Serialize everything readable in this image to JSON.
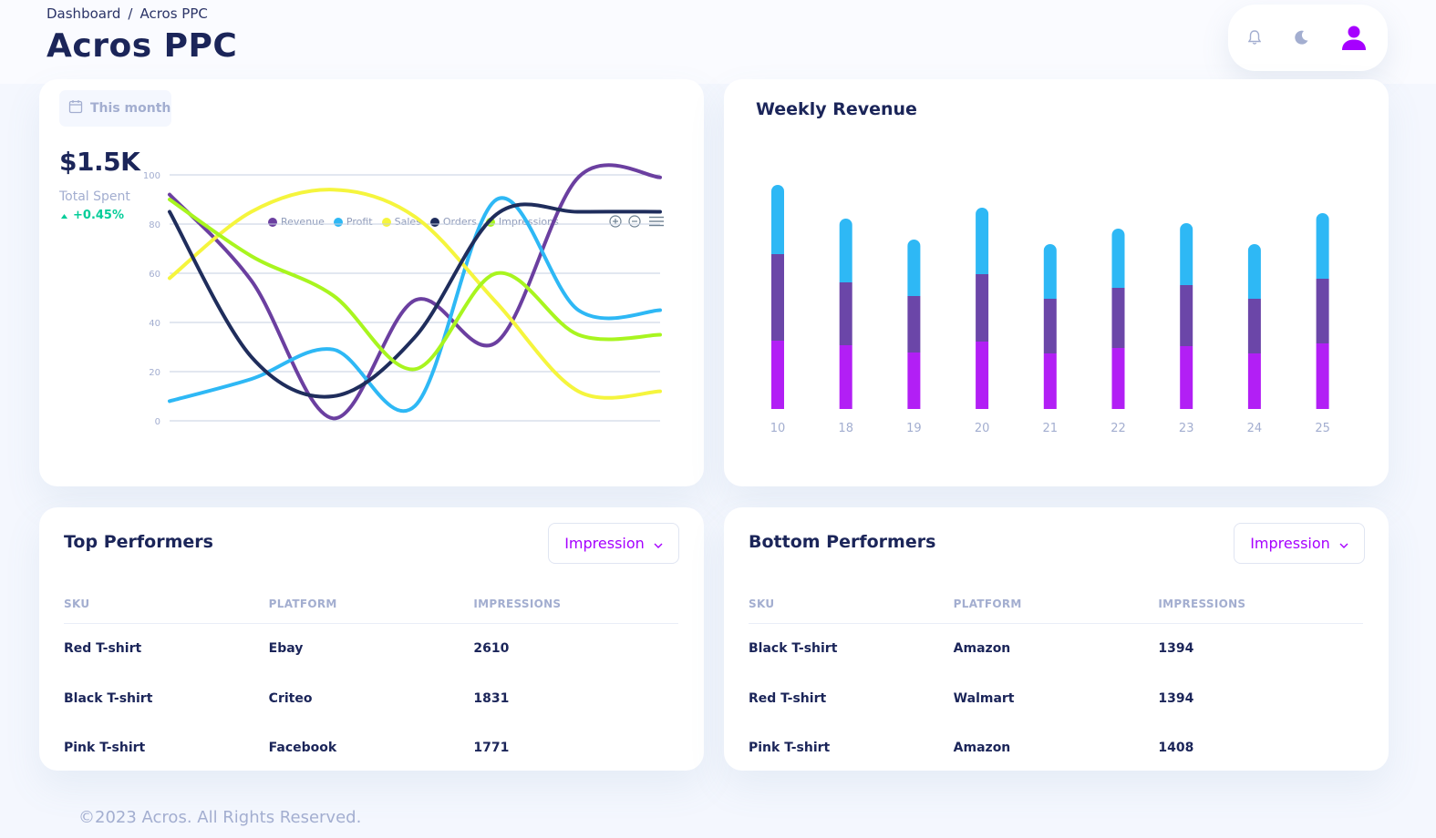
{
  "header": {
    "breadcrumb": [
      "Dashboard",
      "/",
      "Acros PPC"
    ],
    "title": "Acros PPC",
    "icons": [
      "bell-icon",
      "moon-icon",
      "user-icon"
    ]
  },
  "colors": {
    "accent": "#a600ff",
    "revenue": "#6b3fa0",
    "profit": "#2eb8f5",
    "sales": "#f5f53d",
    "orders": "#1f2d5c",
    "impressions": "#a8f51f",
    "bar_top": "#2eb8f5",
    "bar_mid": "#6b46a8",
    "bar_bottom": "#b21ff5",
    "positive": "#05cd99"
  },
  "spend_card": {
    "date_filter": "This month",
    "value": "$1.5K",
    "label": "Total Spent",
    "trend": "+0.45%"
  },
  "weekly_card": {
    "title": "Weekly Revenue"
  },
  "chart_data": [
    {
      "type": "line",
      "smooth": true,
      "legend_position": "top",
      "grid": true,
      "ylim": [
        0,
        100
      ],
      "yticks": [
        0,
        20,
        40,
        60,
        80,
        100
      ],
      "x": [
        1,
        2,
        3,
        4,
        5,
        6,
        7
      ],
      "series": [
        {
          "name": "Revenue",
          "color": "#6b3fa0",
          "values": [
            92,
            57,
            1,
            49,
            32,
            99,
            99
          ]
        },
        {
          "name": "Profit",
          "color": "#2eb8f5",
          "values": [
            8,
            17,
            29,
            6,
            90,
            45,
            45
          ]
        },
        {
          "name": "Sales",
          "color": "#f5f53d",
          "values": [
            58,
            85,
            94,
            83,
            48,
            12,
            12
          ]
        },
        {
          "name": "Orders",
          "color": "#1f2d5c",
          "values": [
            85,
            26,
            10,
            34,
            84,
            85,
            85
          ]
        },
        {
          "name": "Impressions",
          "color": "#a8f51f",
          "values": [
            90,
            67,
            51,
            21,
            60,
            35,
            35
          ]
        }
      ]
    },
    {
      "type": "bar",
      "stacked": true,
      "categories": [
        "10",
        "18",
        "19",
        "20",
        "21",
        "22",
        "23",
        "24",
        "25"
      ],
      "series": [
        {
          "color": "#b21ff5",
          "values": [
            75,
            70,
            62,
            74,
            61,
            67,
            69,
            61,
            72
          ]
        },
        {
          "color": "#6b46a8",
          "values": [
            95,
            69,
            62,
            74,
            60,
            66,
            67,
            60,
            71
          ]
        },
        {
          "color": "#2eb8f5",
          "values": [
            76,
            70,
            62,
            73,
            60,
            65,
            68,
            60,
            72
          ]
        }
      ]
    }
  ],
  "top_performers": {
    "title": "Top Performers",
    "select": "Impression",
    "columns": [
      "SKU",
      "PLATFORM",
      "IMPRESSIONS"
    ],
    "rows": [
      [
        "Red T-shirt",
        "Ebay",
        "2610"
      ],
      [
        "Black T-shirt",
        "Criteo",
        "1831"
      ],
      [
        "Pink T-shirt",
        "Facebook",
        "1771"
      ]
    ]
  },
  "bottom_performers": {
    "title": "Bottom Performers",
    "select": "Impression",
    "columns": [
      "SKU",
      "PLATFORM",
      "IMPRESSIONS"
    ],
    "rows": [
      [
        "Black T-shirt",
        "Amazon",
        "1394"
      ],
      [
        "Red T-shirt",
        "Walmart",
        "1394"
      ],
      [
        "Pink T-shirt",
        "Amazon",
        "1408"
      ]
    ]
  },
  "footer": {
    "text": "©2023 Acros. All Rights Reserved."
  }
}
